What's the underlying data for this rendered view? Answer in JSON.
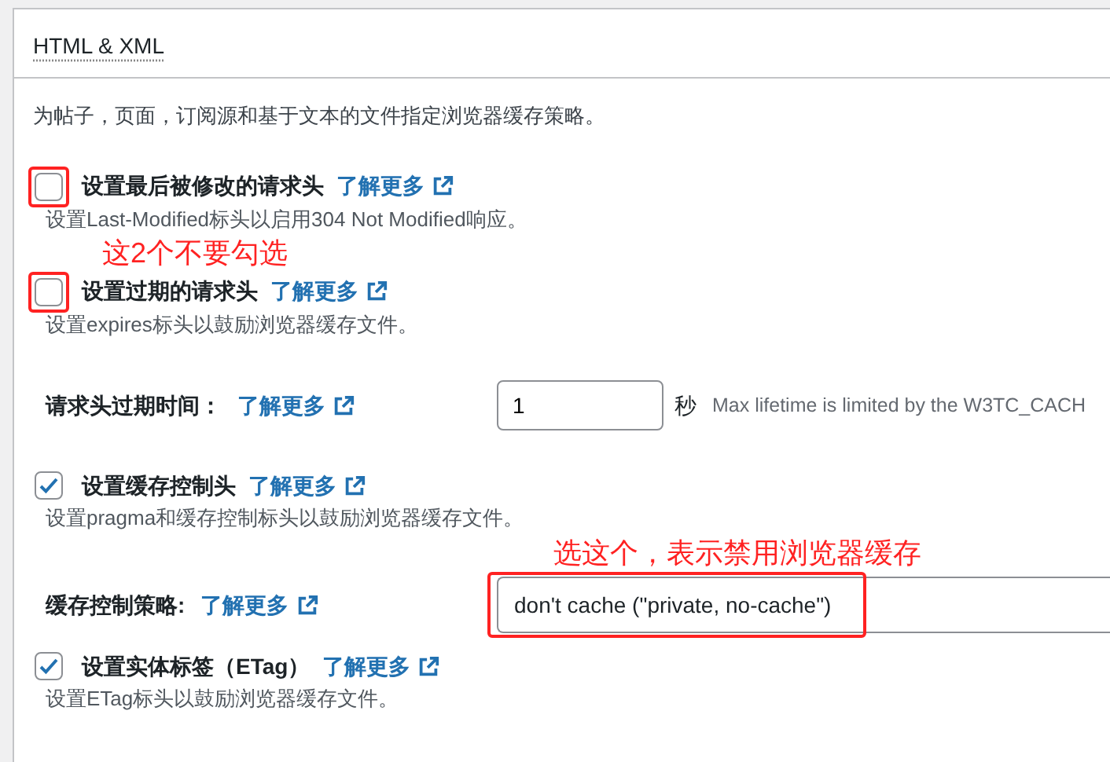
{
  "section": {
    "title": "HTML & XML",
    "description": "为帖子，页面，订阅源和基于文本的文件指定浏览器缓存策略。"
  },
  "settings": [
    {
      "kind": "checkbox",
      "label": "设置最后被修改的请求头",
      "link": "了解更多",
      "checked": false,
      "highlighted": true,
      "help": "设置Last-Modified标头以启用304 Not Modified响应。"
    },
    {
      "kind": "checkbox",
      "annotation": "这2个不要勾选",
      "label": "设置过期的请求头",
      "link": "了解更多",
      "checked": false,
      "highlighted": true,
      "help": "设置expires标头以鼓励浏览器缓存文件。"
    },
    {
      "kind": "number",
      "label": "请求头过期时间：",
      "link": "了解更多",
      "value": "1",
      "unit": "秒",
      "note": "Max lifetime is limited by the W3TC_CACH"
    },
    {
      "kind": "checkbox",
      "label": "设置缓存控制头",
      "link": "了解更多",
      "checked": true,
      "highlighted": false,
      "help": "设置pragma和缓存控制标头以鼓励浏览器缓存文件。"
    },
    {
      "kind": "select",
      "annotation": "选这个，表示禁用浏览器缓存",
      "label": "缓存控制策略:",
      "link": "了解更多",
      "value": "don't cache (\"private, no-cache\")",
      "highlighted": true
    },
    {
      "kind": "checkbox",
      "label": "设置实体标签（ETag）",
      "link": "了解更多",
      "checked": true,
      "highlighted": false,
      "help": "设置ETag标头以鼓励浏览器缓存文件。"
    }
  ]
}
